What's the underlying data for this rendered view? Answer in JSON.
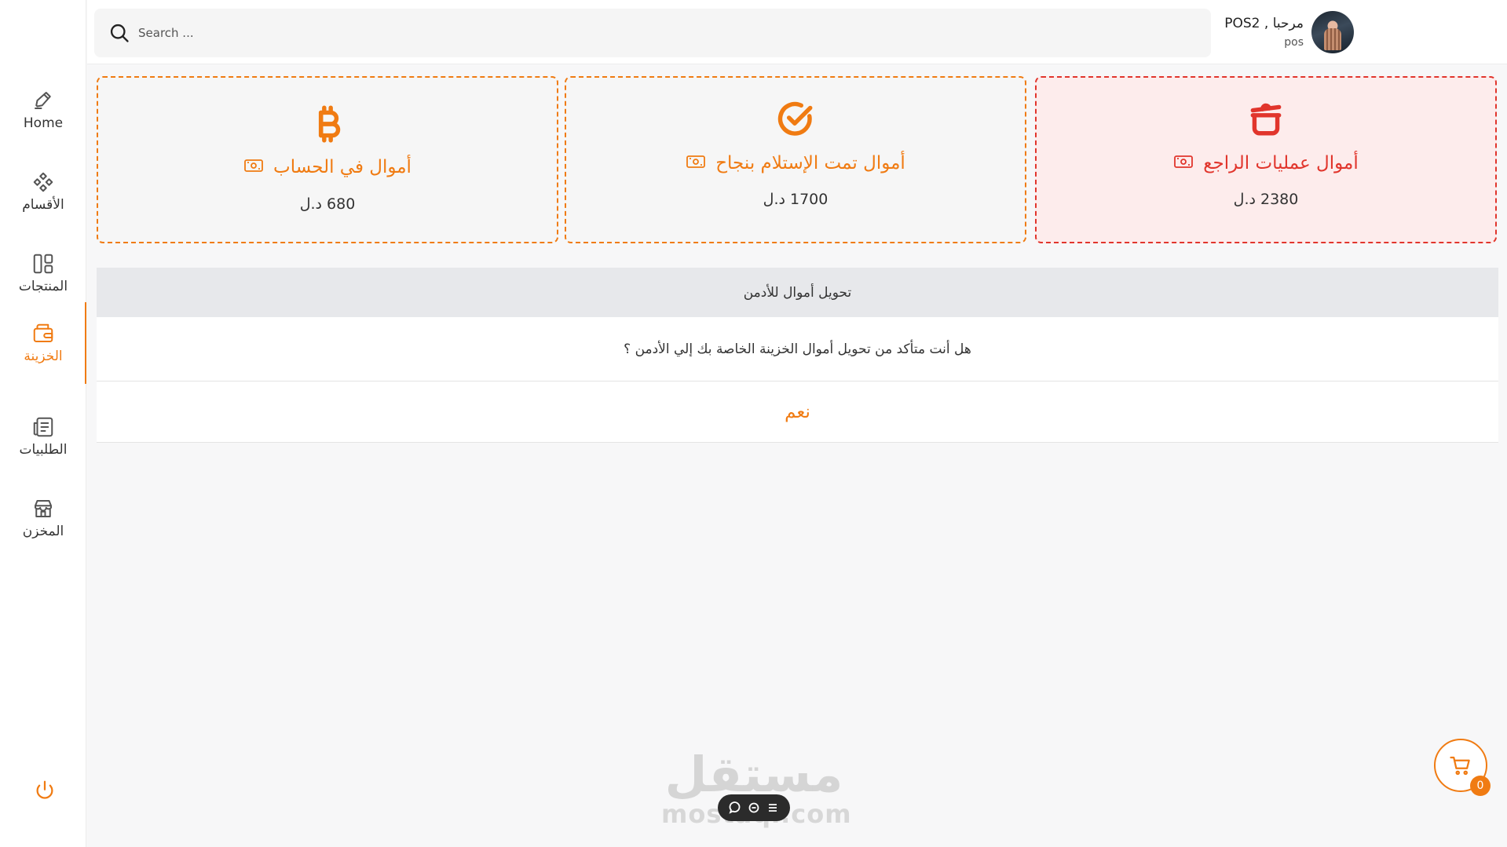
{
  "sidebar": {
    "items": [
      {
        "label": "Home",
        "icon": "home-edit-icon"
      },
      {
        "label": "الأقسام",
        "icon": "categories-icon"
      },
      {
        "label": "المنتجات",
        "icon": "products-grid-icon"
      },
      {
        "label": "الخزينة",
        "icon": "wallet-icon",
        "active": true
      },
      {
        "label": "الطلبيات",
        "icon": "orders-icon"
      },
      {
        "label": "المخزن",
        "icon": "store-icon"
      }
    ],
    "logout_icon": "power-icon"
  },
  "header": {
    "search_placeholder": "Search ...",
    "user_greeting": "مرحبا , POS2",
    "user_role": "pos"
  },
  "cards": [
    {
      "title": "أموال عمليات الراجع",
      "amount": "2380 د.ل",
      "icon": "pot-icon",
      "color": "#e1352c"
    },
    {
      "title": "أموال تمت الإستلام بنجاح",
      "amount": "1700 د.ل",
      "icon": "check-circle-icon",
      "color": "#f07b12"
    },
    {
      "title": "أموال في الحساب",
      "amount": "680 د.ل",
      "icon": "bitcoin-icon",
      "color": "#f07b12"
    }
  ],
  "transfer": {
    "header": "تحويل أموال للأدمن",
    "question": "هل أنت متأكد من تحويل أموال الخزينة الخاصة بك إلي الأدمن ؟",
    "confirm_label": "نعم"
  },
  "cart": {
    "count": "0"
  },
  "watermark": {
    "arabic": "مستقل",
    "latin": "mostaql.com"
  },
  "colors": {
    "accent": "#f07b12",
    "danger": "#e1352c"
  }
}
